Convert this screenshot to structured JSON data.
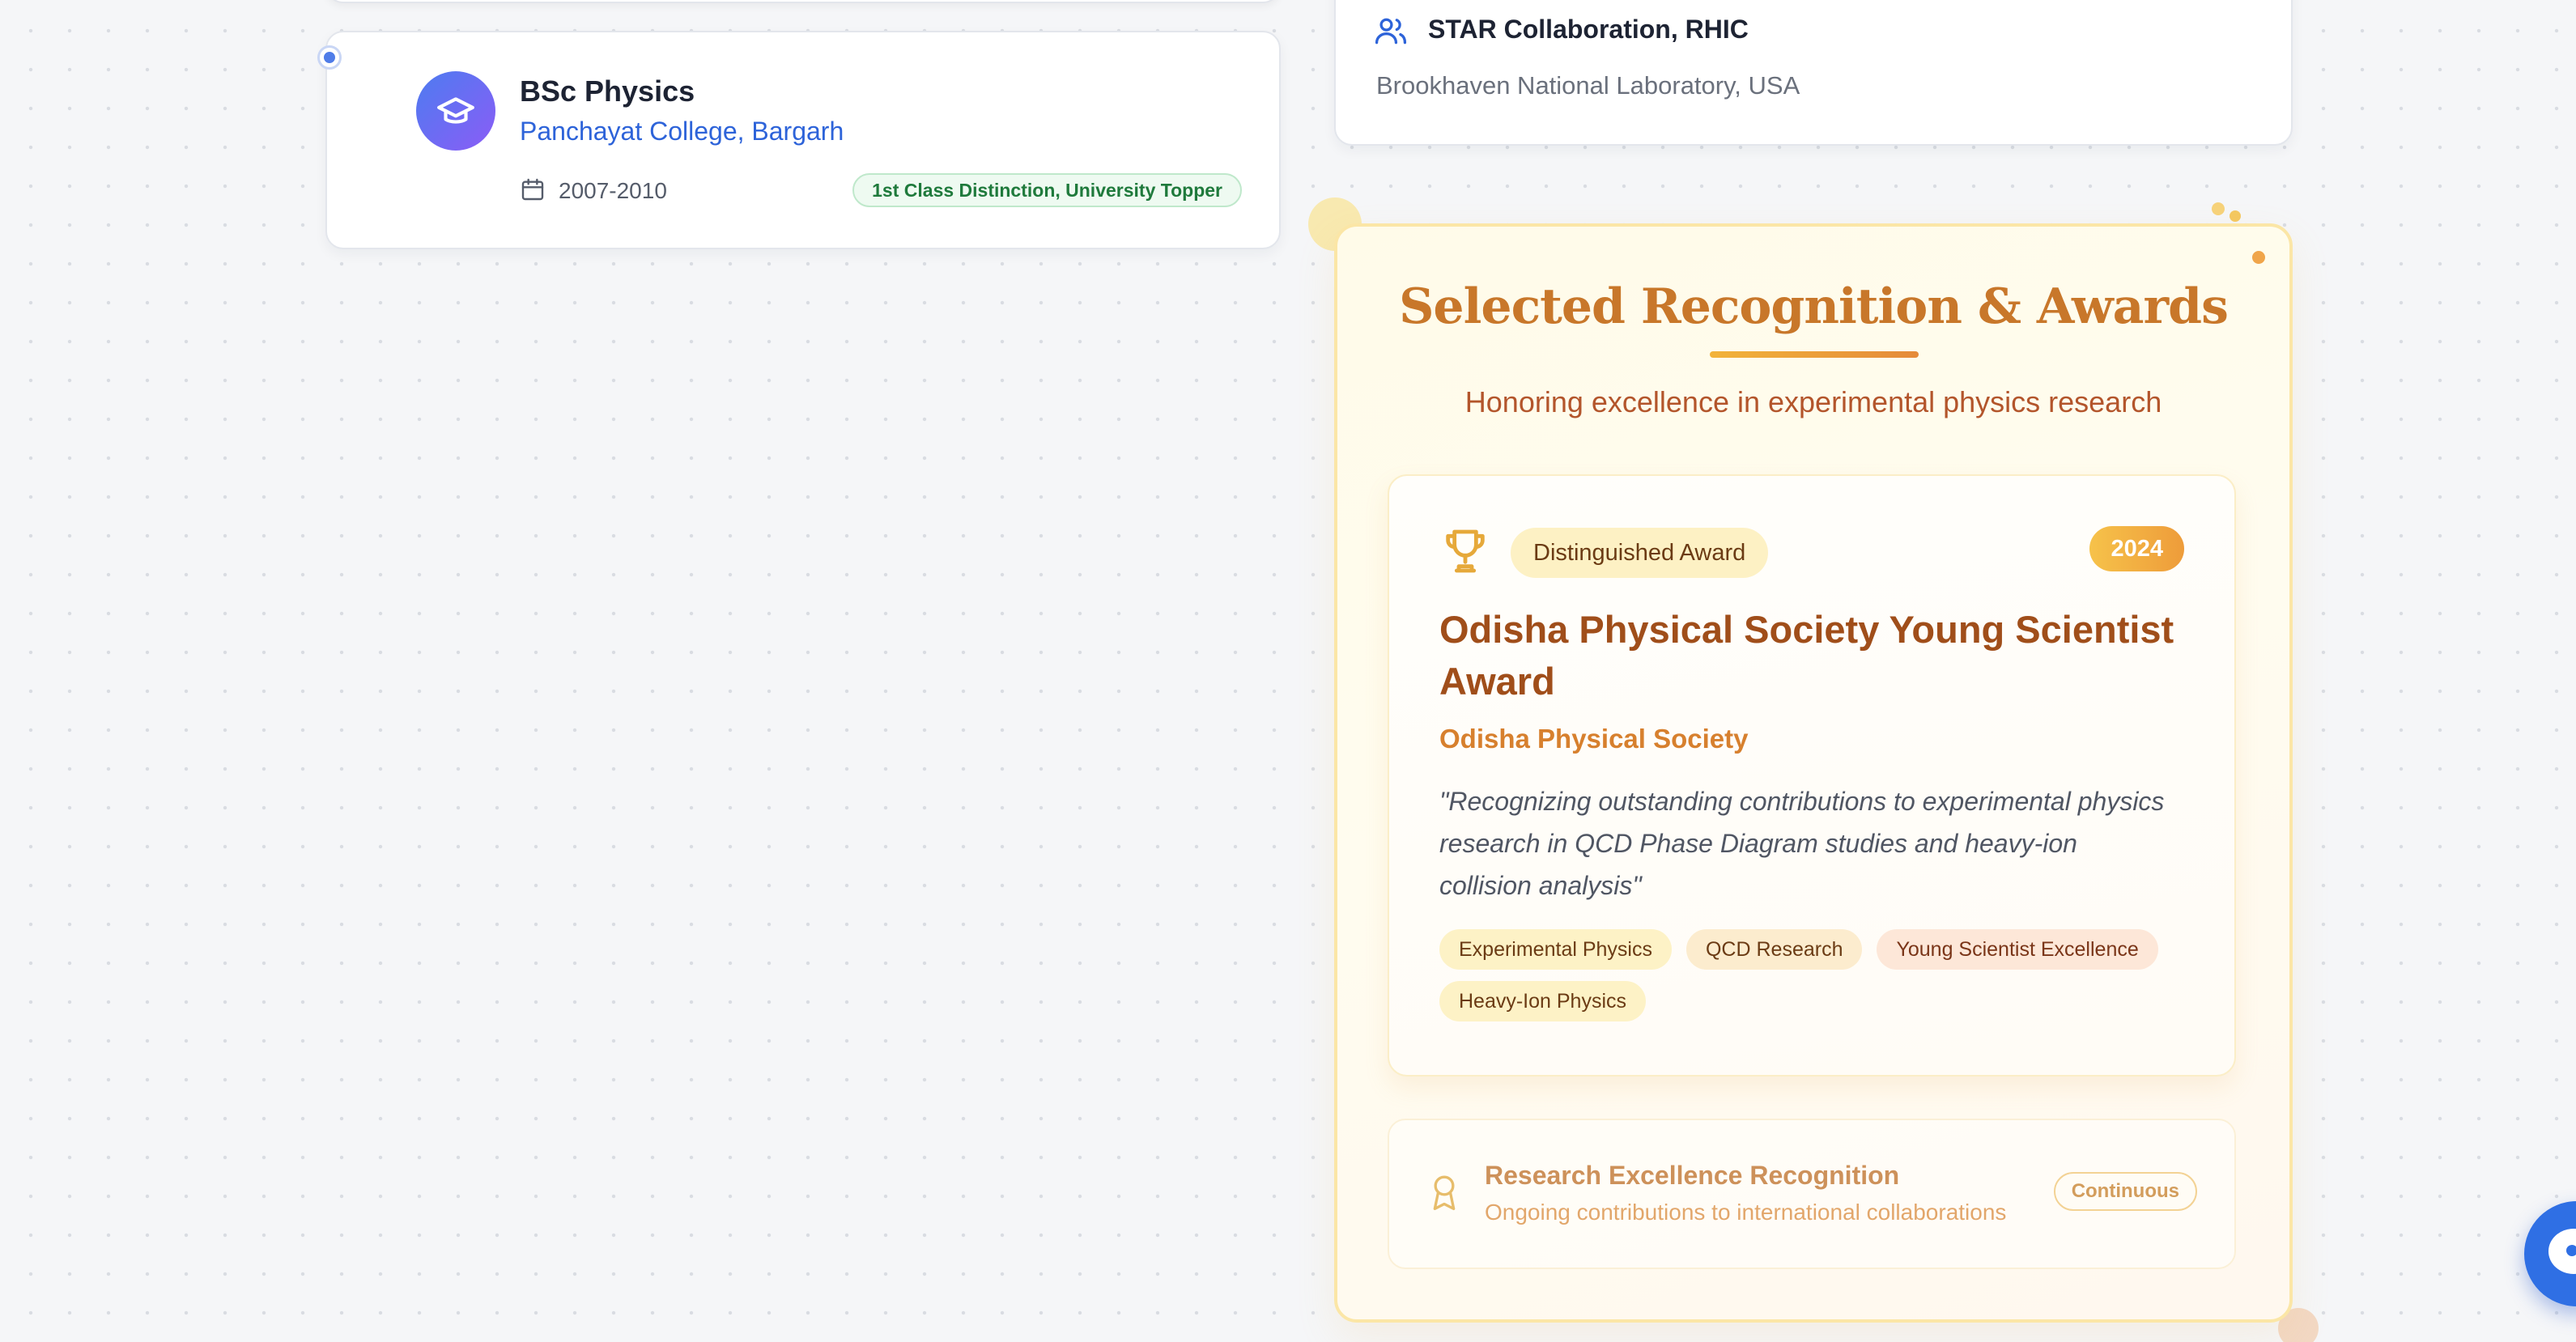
{
  "education": {
    "degree": "BSc Physics",
    "institution": "Panchayat College, Bargarh",
    "years": "2007-2010",
    "honor": "1st Class Distinction, University Topper"
  },
  "collaboration": {
    "name": "STAR Collaboration, RHIC",
    "location": "Brookhaven National Laboratory, USA"
  },
  "awards": {
    "title": "Selected Recognition & Awards",
    "subtitle": "Honoring excellence in experimental physics research",
    "featured": {
      "label": "Distinguished Award",
      "year": "2024",
      "name": "Odisha Physical Society Young Scientist Award",
      "organization": "Odisha Physical Society",
      "quote": "\"Recognizing outstanding contributions to experimental physics research in QCD Phase Diagram studies and heavy-ion collision analysis\"",
      "tags": [
        "Experimental Physics",
        "QCD Research",
        "Young Scientist Excellence",
        "Heavy-Ion Physics"
      ]
    },
    "secondary": {
      "title": "Research Excellence Recognition",
      "description": "Ongoing contributions to international collaborations",
      "badge": "Continuous"
    }
  },
  "colors": {
    "accent_blue": "#2d63d9",
    "award_gold": "#c8772a",
    "award_dark": "#a04e1a",
    "success_green": "#1f7a3c"
  },
  "icons": {
    "education": "graduation-cap-icon",
    "date": "calendar-icon",
    "collaboration": "users-icon",
    "featured_award": "trophy-icon",
    "secondary_award": "award-ribbon-icon",
    "chat": "chat-icon"
  }
}
